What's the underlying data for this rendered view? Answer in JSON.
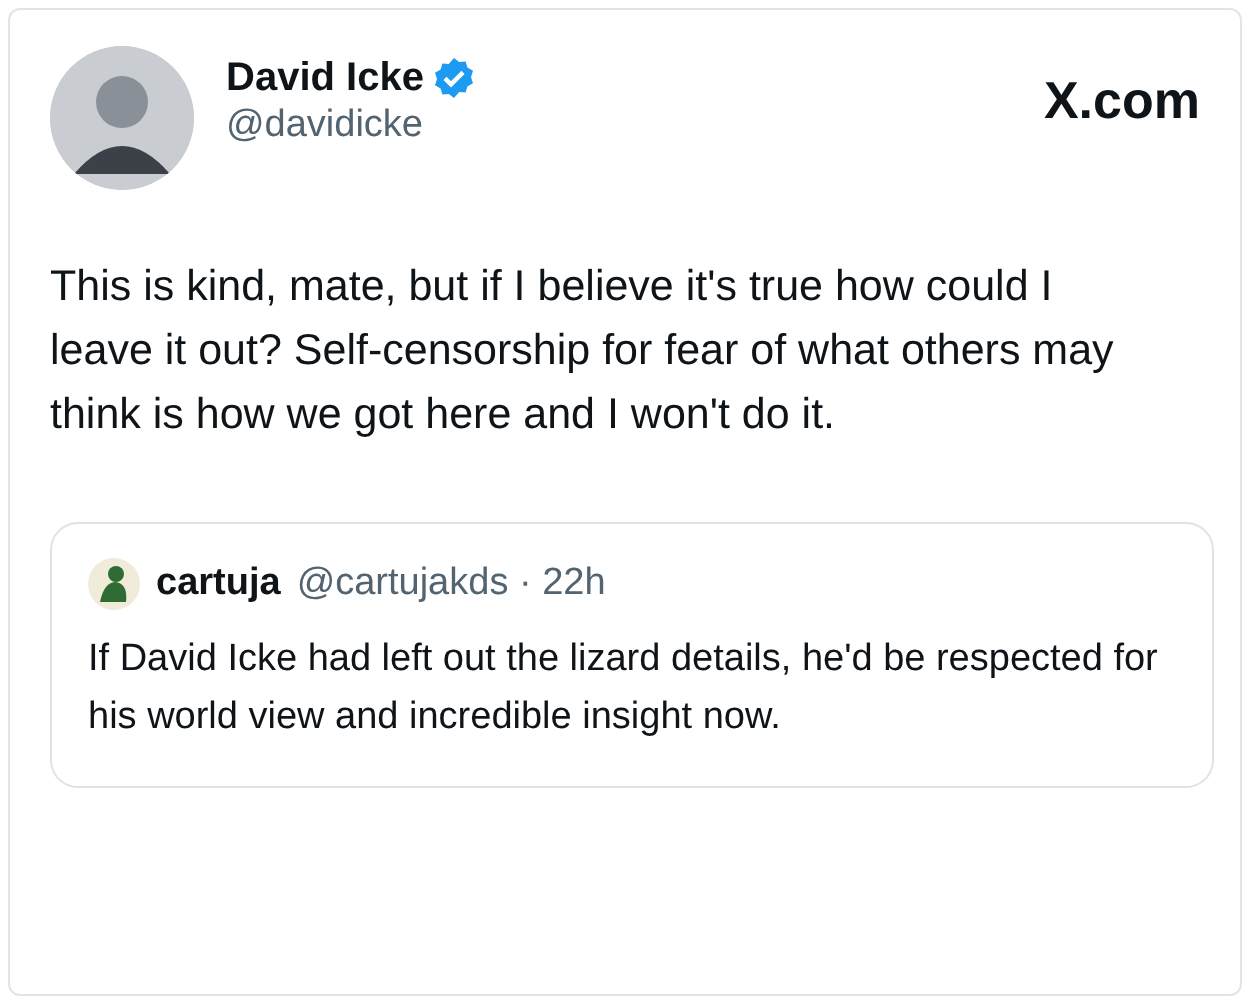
{
  "author": {
    "name": "David Icke",
    "verified": true,
    "handle": "@davidicke"
  },
  "site": "X.com",
  "text": "This is kind, mate, but if I believe it's true how could I leave it out? Self-censorship for fear of what others may think is how we got here and I won't do it.",
  "quote": {
    "name": "cartuja",
    "handle": "@cartujakds",
    "separator": "·",
    "time": "22h",
    "text": "If David Icke had left out the lizard details, he'd be respected for his world view and incredible insight now."
  }
}
